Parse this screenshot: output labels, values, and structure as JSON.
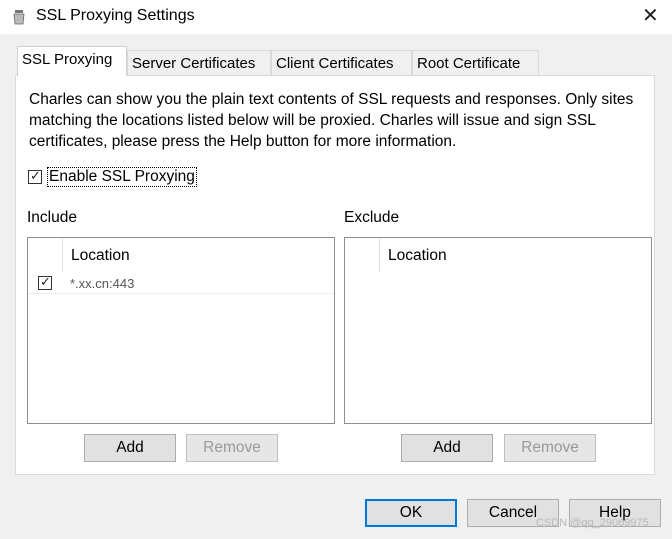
{
  "window": {
    "title": "SSL Proxying Settings",
    "close_glyph": "✕"
  },
  "tabs": [
    {
      "label": "SSL Proxying",
      "active": true
    },
    {
      "label": "Server Certificates",
      "active": false
    },
    {
      "label": "Client Certificates",
      "active": false
    },
    {
      "label": "Root Certificate",
      "active": false
    }
  ],
  "description": "Charles can show you the plain text contents of SSL requests and responses. Only sites matching the locations listed below will be proxied. Charles will issue and sign SSL certificates, please press the Help button for more information.",
  "enable_ssl": {
    "label": "Enable SSL Proxying",
    "checked": true
  },
  "include": {
    "title": "Include",
    "column": "Location",
    "rows": [
      {
        "checked": true,
        "location": "*.xx.cn:443"
      }
    ],
    "add_label": "Add",
    "remove_label": "Remove"
  },
  "exclude": {
    "title": "Exclude",
    "column": "Location",
    "rows": [],
    "add_label": "Add",
    "remove_label": "Remove"
  },
  "footer": {
    "ok_label": "OK",
    "cancel_label": "Cancel",
    "help_label": "Help"
  },
  "watermark": "CSDN @qq_29069975",
  "icons": {
    "app": "charles-jar-icon",
    "check": "check-icon",
    "close": "close-icon"
  },
  "colors": {
    "primary_border": "#0078d7"
  }
}
